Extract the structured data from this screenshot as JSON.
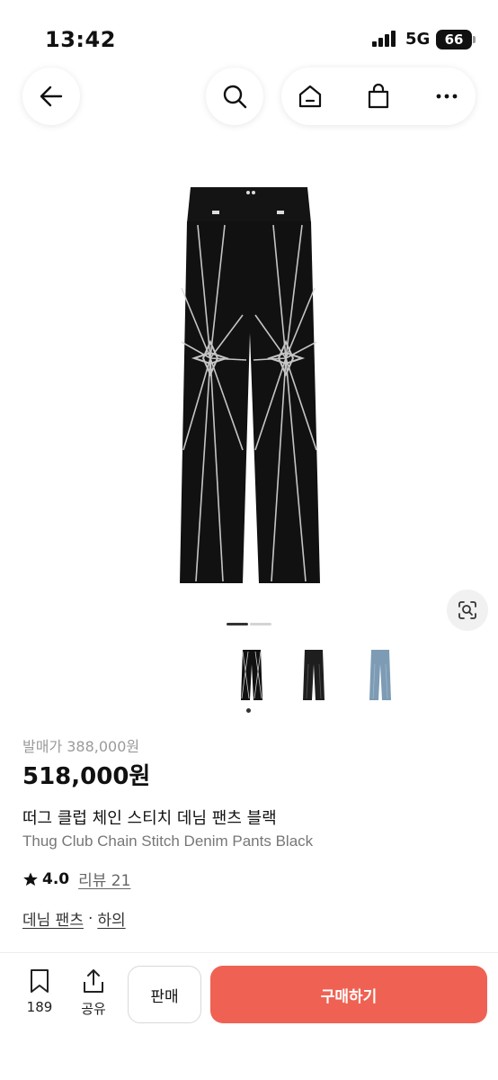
{
  "status_bar": {
    "time": "13:42",
    "network": "5G",
    "battery": "66"
  },
  "colors": {
    "buy_button": "#ef6253",
    "text": "#111111",
    "muted": "#9a9a9a"
  },
  "icons": [
    "back-arrow-icon",
    "search-icon",
    "home-icon",
    "shopping-bag-icon",
    "more-icon",
    "visual-search-icon",
    "bookmark-icon",
    "share-icon",
    "star-icon"
  ],
  "gallery": {
    "active_index": 0,
    "page_count": 2,
    "thumbnail_count": 3
  },
  "product": {
    "original_price": "발매가 388,000원",
    "price": "518,000원",
    "title_ko": "떠그 클럽 체인 스티치 데님 팬츠 블랙",
    "title_en": "Thug Club Chain Stitch Denim Pants Black",
    "rating": "4.0",
    "review_link": "리뷰 21",
    "categories": [
      "데님 팬츠",
      "하의"
    ],
    "category_separator": "·"
  },
  "bottom_bar": {
    "bookmark_count": "189",
    "share_label": "공유",
    "sell_label": "판매",
    "buy_label": "구매하기"
  }
}
